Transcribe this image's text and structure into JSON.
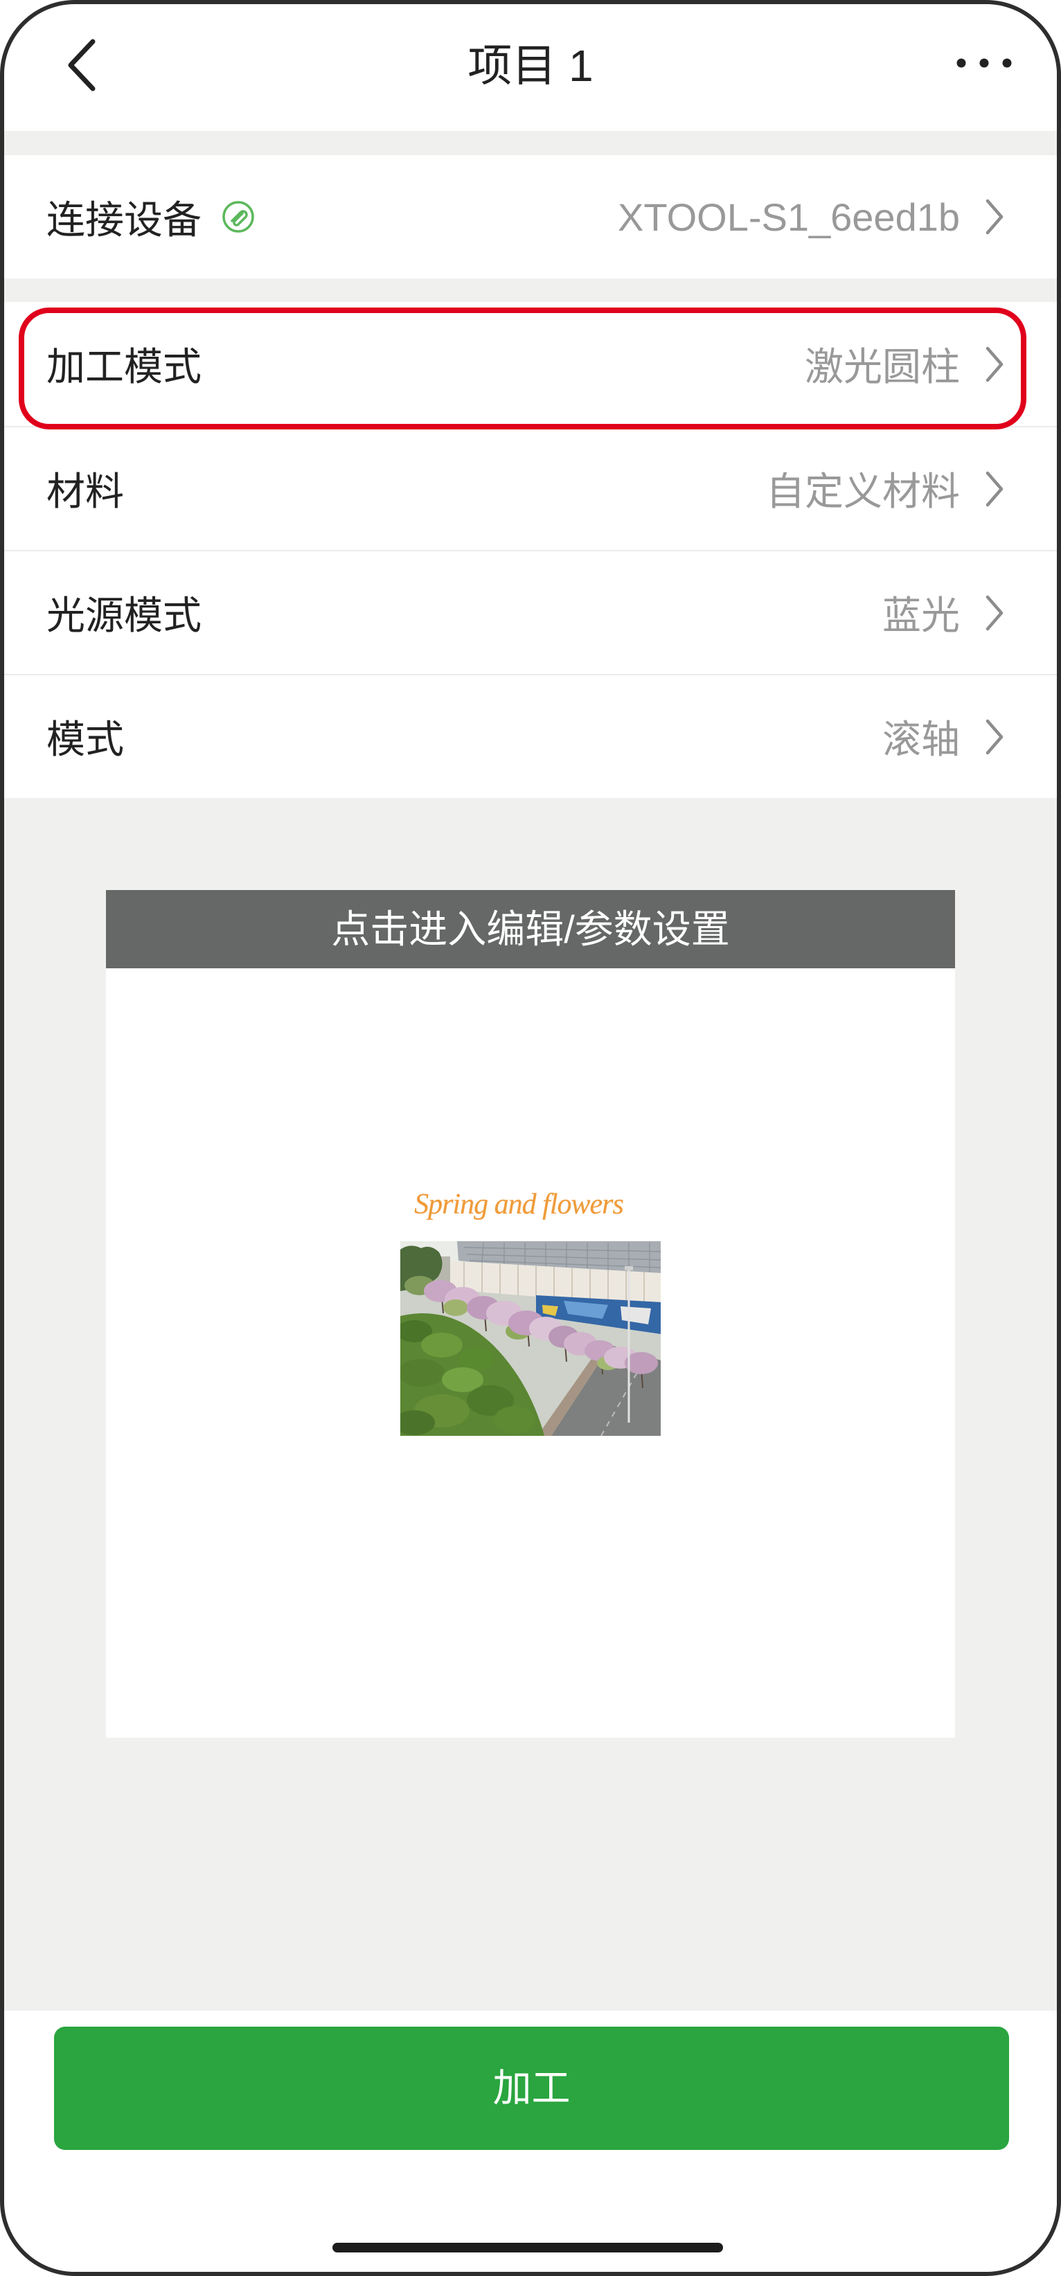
{
  "colors": {
    "page_bg": "#f0f0ee",
    "accent_green": "#2aa53f",
    "status_green": "#5cb85c",
    "highlight_red": "#e0001b",
    "preview_header_bg": "#666867",
    "value_gray": "#999999",
    "text_dark": "#222222"
  },
  "header": {
    "back_icon": "chevron-left-icon",
    "title": "项目 1",
    "more_icon": "more-horizontal-icon"
  },
  "device": {
    "label": "连接设备",
    "status_icon": "connected-link-icon",
    "value": "XTOOL-S1_6eed1b",
    "chevron_icon": "chevron-right-icon"
  },
  "settings": [
    {
      "label": "加工模式",
      "value": "激光圆柱",
      "highlighted": true
    },
    {
      "label": "材料",
      "value": "自定义材料",
      "highlighted": false
    },
    {
      "label": "光源模式",
      "value": "蓝光",
      "highlighted": false
    },
    {
      "label": "模式",
      "value": "滚轴",
      "highlighted": false
    }
  ],
  "preview": {
    "header_label": "点击进入编辑/参数设置",
    "design_text": "Spring and flowers"
  },
  "actions": {
    "process_label": "加工"
  }
}
